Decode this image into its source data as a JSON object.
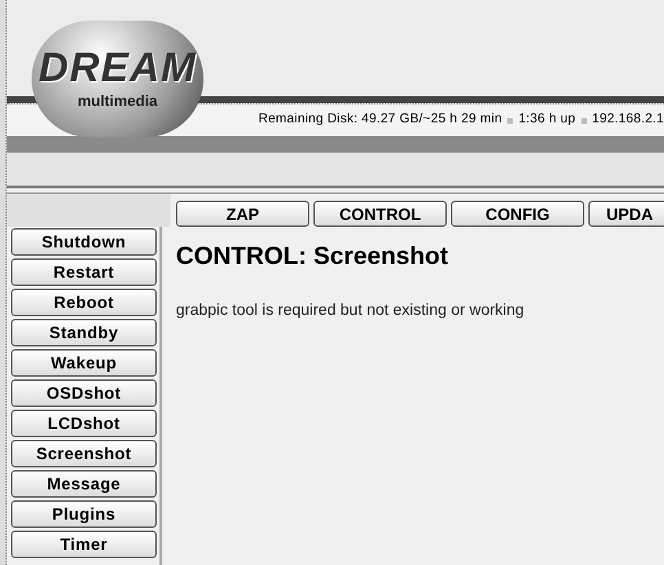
{
  "logo": {
    "word": "DREAM",
    "tagline": "multimedia"
  },
  "status": {
    "items": [
      "Remaining Disk: 49.27 GB/~25 h 29 min",
      "1:36 h up",
      "192.168.2.1"
    ]
  },
  "top_nav": [
    "ZAP",
    "CONTROL",
    "CONFIG",
    "UPDA"
  ],
  "sidebar": {
    "items": [
      "Shutdown",
      "Restart",
      "Reboot",
      "Standby",
      "Wakeup",
      "OSDshot",
      "LCDshot",
      "Screenshot",
      "Message",
      "Plugins",
      "Timer"
    ]
  },
  "content": {
    "title": "CONTROL: Screenshot",
    "message": "grabpic tool is required but not existing or working"
  }
}
